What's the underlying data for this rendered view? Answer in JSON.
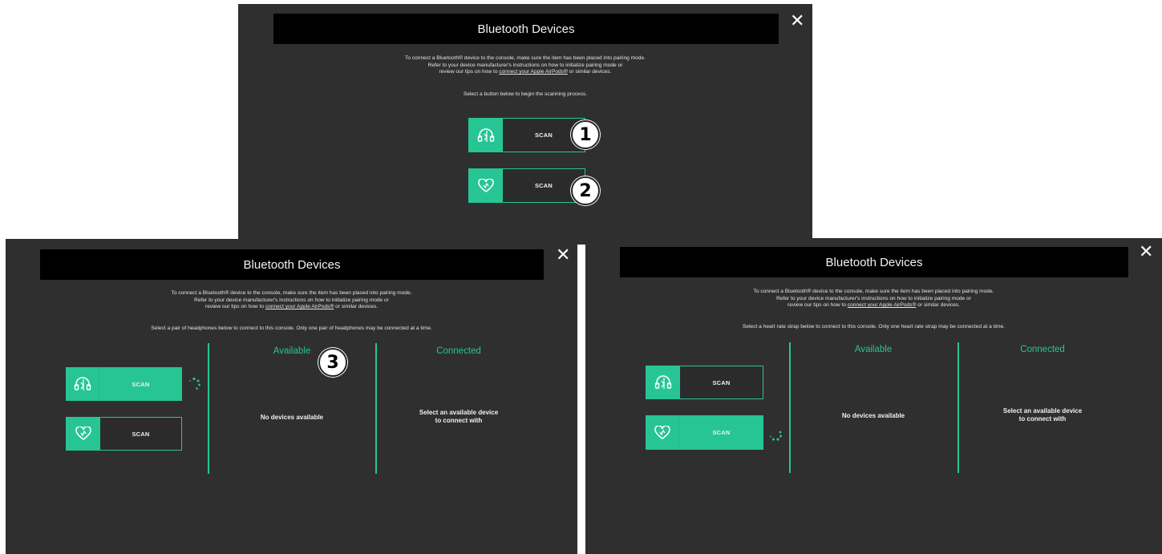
{
  "dialog": {
    "title": "Bluetooth Devices",
    "close_symbol": "✕",
    "intro_line1": "To connect a Bluetooth® device to the console, make sure the item has been placed into pairing mode.",
    "intro_line2": "Refer to your device manufacturer's instructions on how to initialize pairing mode or",
    "intro_line3_pre": "review our tips on how to",
    "intro_link": "connect your Apple AirPods®",
    "intro_line3_post": "or similar devices.",
    "scan_label": "SCAN"
  },
  "top_panel": {
    "prompt": "Select a button below to begin the scanning process.",
    "buttons": [
      {
        "icon": "headphones-icon",
        "label": "SCAN",
        "badge": "1"
      },
      {
        "icon": "heart-icon",
        "label": "SCAN",
        "badge": "2"
      }
    ]
  },
  "left_panel": {
    "prompt": "Select a pair of headphones below to connect to this console. Only one pair of headphones may be connected at a time.",
    "available_header": "Available",
    "connected_header": "Connected",
    "available_text": "No devices available",
    "connected_text_1": "Select an available device",
    "connected_text_2": "to connect with",
    "badge": "3",
    "active_button": "headphones"
  },
  "right_panel": {
    "prompt": "Select a heart rate strap below to connect to this console. Only one heart rate strap may be connected at a time.",
    "available_header": "Available",
    "connected_header": "Connected",
    "available_text": "No devices available",
    "connected_text_1": "Select an available device",
    "connected_text_2": "to connect with",
    "active_button": "heart"
  },
  "colors": {
    "accent": "#27c593",
    "panel_bg": "#2f2f2f",
    "titlebar_bg": "#000000"
  }
}
